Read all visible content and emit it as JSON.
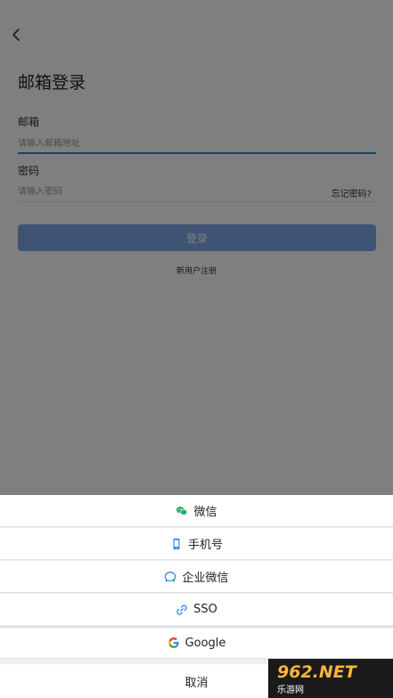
{
  "header": {
    "back_icon": "chevron-left-icon",
    "title": "邮箱登录"
  },
  "form": {
    "email_label": "邮箱",
    "email_placeholder": "请输入邮箱地址",
    "password_label": "密码",
    "password_placeholder": "请输入密码",
    "forgot_label": "忘记密码?",
    "login_label": "登录",
    "register_label": "新用户注册"
  },
  "sheet": {
    "options": [
      {
        "label": "微信",
        "icon": "wechat-icon"
      },
      {
        "label": "手机号",
        "icon": "phone-icon"
      },
      {
        "label": "企业微信",
        "icon": "wecom-icon"
      },
      {
        "label": "SSO",
        "icon": "link-icon"
      },
      {
        "label": "Google",
        "icon": "google-icon"
      }
    ],
    "cancel_label": "取消"
  },
  "watermark": {
    "top": "962.NET",
    "bottom": "乐游网"
  },
  "colors": {
    "accent": "#3f7bd9",
    "button": "#7ea8e8",
    "wechat": "#2aae67"
  }
}
